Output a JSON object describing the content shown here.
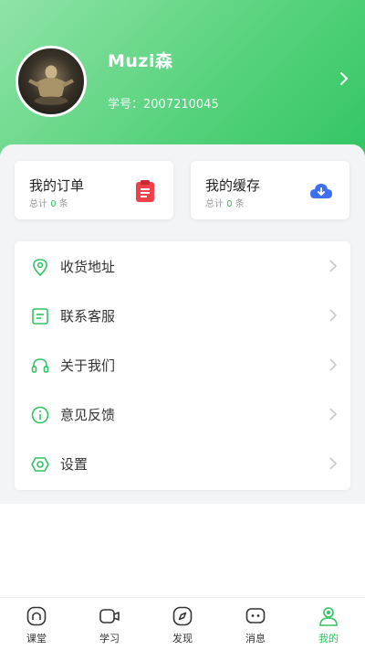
{
  "profile": {
    "name": "Muzi森",
    "student_id": "学号：2007210045"
  },
  "cards": {
    "orders": {
      "title": "我的订单",
      "count_prefix": "总计",
      "count_value": "0",
      "count_suffix": "条"
    },
    "cache": {
      "title": "我的缓存",
      "count_prefix": "总计",
      "count_value": "0",
      "count_suffix": "条"
    }
  },
  "menu": [
    {
      "label": "收货地址",
      "icon": "location-icon"
    },
    {
      "label": "联系客服",
      "icon": "service-note-icon"
    },
    {
      "label": "关于我们",
      "icon": "headset-icon"
    },
    {
      "label": "意见反馈",
      "icon": "info-icon"
    },
    {
      "label": "设置",
      "icon": "settings-icon"
    }
  ],
  "tabs": [
    {
      "label": "课堂",
      "icon": "home-icon"
    },
    {
      "label": "学习",
      "icon": "video-icon"
    },
    {
      "label": "发现",
      "icon": "compass-icon"
    },
    {
      "label": "消息",
      "icon": "message-icon"
    },
    {
      "label": "我的",
      "icon": "profile-icon",
      "active": true
    }
  ],
  "colors": {
    "accent": "#2fc462",
    "header_gradient_start": "#8fe3a6",
    "header_gradient_end": "#2fc462",
    "orders_icon": "#f0414a",
    "cache_icon": "#3e6ff0"
  }
}
